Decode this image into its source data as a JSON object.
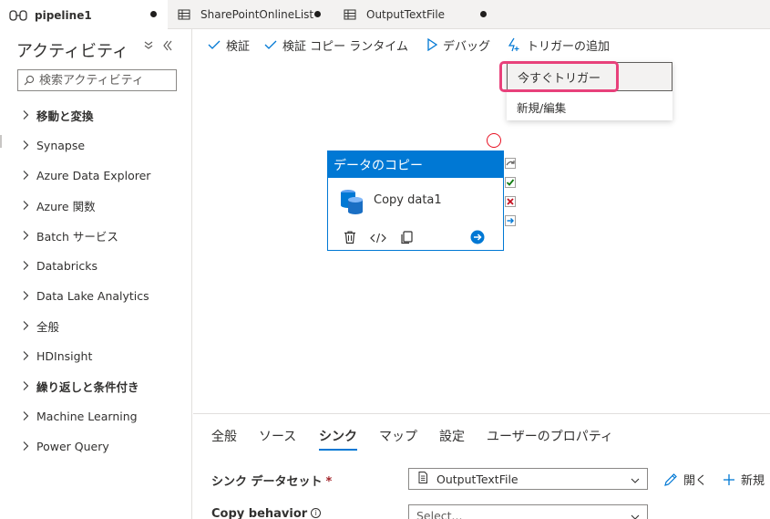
{
  "tabs": [
    {
      "label": "pipeline1",
      "icon": "pipeline-icon",
      "active": true
    },
    {
      "label": "SharePointOnlineList",
      "icon": "table-icon",
      "active": false
    },
    {
      "label": "OutputTextFile",
      "icon": "table-icon",
      "active": false
    }
  ],
  "sidebar": {
    "title": "アクティビティ",
    "search_placeholder": "検索アクティビティ",
    "items": [
      {
        "label": "移動と変換",
        "bold": true
      },
      {
        "label": "Synapse",
        "bold": false
      },
      {
        "label": "Azure Data Explorer",
        "bold": false
      },
      {
        "label": "Azure 関数",
        "bold": false
      },
      {
        "label": "Batch サービス",
        "bold": false
      },
      {
        "label": "Databricks",
        "bold": false
      },
      {
        "label": "Data Lake Analytics",
        "bold": false
      },
      {
        "label": "全般",
        "bold": false
      },
      {
        "label": "HDInsight",
        "bold": false
      },
      {
        "label": "繰り返しと条件付き",
        "bold": true
      },
      {
        "label": "Machine Learning",
        "bold": false
      },
      {
        "label": "Power Query",
        "bold": false
      }
    ]
  },
  "toolbar": {
    "validate": "検証",
    "validate_copy_runtime": "検証 コピー ランタイム",
    "debug": "デバッグ",
    "add_trigger": "トリガーの追加"
  },
  "trigger_menu": {
    "trigger_now": "今すぐトリガー",
    "new_edit": "新規/編集"
  },
  "activity": {
    "type_label": "データのコピー",
    "name": "Copy data1"
  },
  "bottom_panel": {
    "tabs": [
      "全般",
      "ソース",
      "シンク",
      "マップ",
      "設定",
      "ユーザーのプロパティ"
    ],
    "active_tab": "シンク",
    "sink_dataset_label": "シンク データセット",
    "required_mark": "*",
    "sink_dataset_value": "OutputTextFile",
    "open_label": "開く",
    "new_label": "新規",
    "copy_behavior_label": "Copy behavior",
    "copy_behavior_placeholder": "Select..."
  },
  "colors": {
    "accent": "#0078d4",
    "highlight": "#e8417b",
    "success": "#107c10",
    "failure": "#c50f1f"
  }
}
